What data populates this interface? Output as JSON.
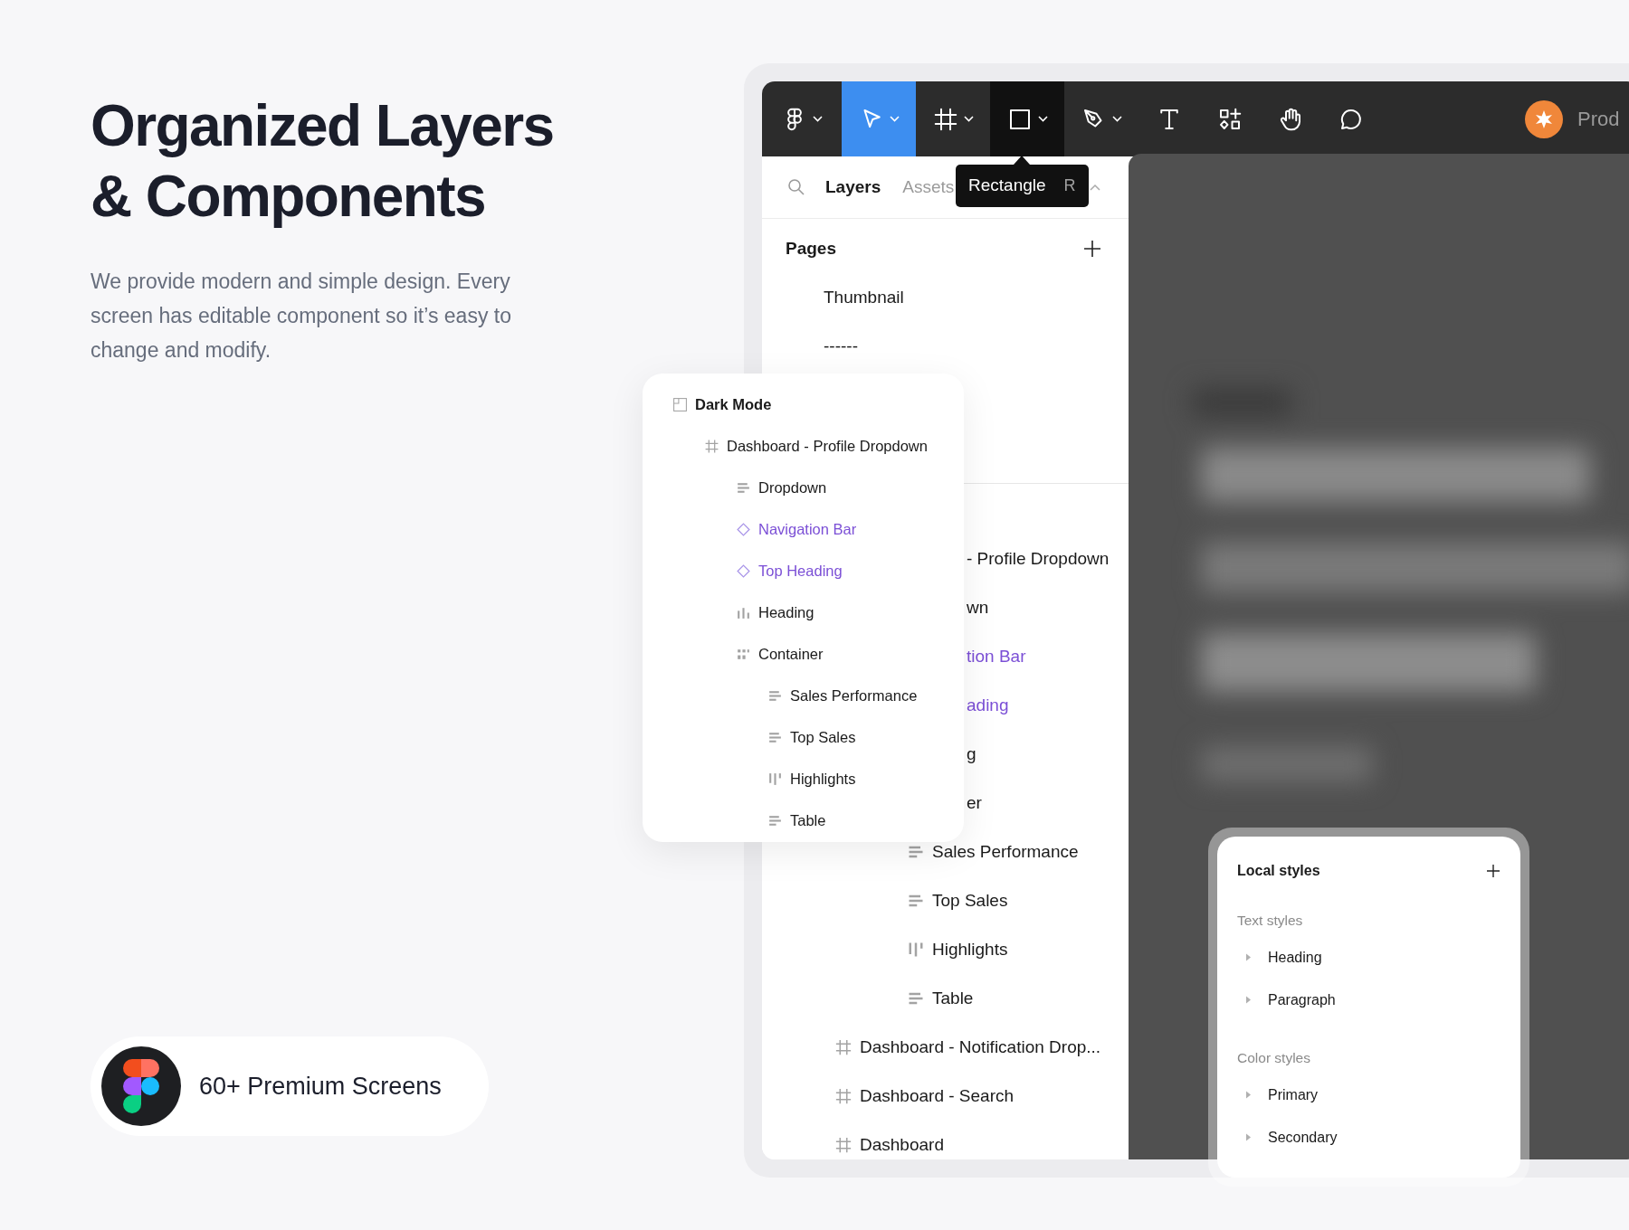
{
  "intro": {
    "title_lines": [
      "Organized Layers",
      "& Components"
    ],
    "description": "We provide modern and simple design. Every screen has editable component so it’s easy to change and modify."
  },
  "badge": {
    "label": "60+ Premium Screens"
  },
  "toolbar": {
    "tools": [
      {
        "kind": "main-menu",
        "selected": false,
        "hovered": false,
        "dropdown": true
      },
      {
        "kind": "move",
        "selected": true,
        "hovered": false,
        "dropdown": true
      },
      {
        "kind": "frame",
        "selected": false,
        "hovered": false,
        "dropdown": true
      },
      {
        "kind": "rectangle",
        "selected": false,
        "hovered": true,
        "dropdown": true
      },
      {
        "kind": "pen",
        "selected": false,
        "hovered": false,
        "dropdown": true
      },
      {
        "kind": "text",
        "selected": false,
        "hovered": false,
        "dropdown": false
      },
      {
        "kind": "resources",
        "selected": false,
        "hovered": false,
        "dropdown": false
      },
      {
        "kind": "hand",
        "selected": false,
        "hovered": false,
        "dropdown": false
      },
      {
        "kind": "comment",
        "selected": false,
        "hovered": false,
        "dropdown": false
      }
    ],
    "file_name": "Prod"
  },
  "tooltip": {
    "label": "Rectangle",
    "shortcut": "R"
  },
  "panel_tabs": [
    {
      "label": "Layers",
      "selected": true
    },
    {
      "label": "Assets",
      "selected": false
    }
  ],
  "pages": {
    "title": "Pages",
    "items": [
      {
        "label": "Thumbnail"
      },
      {
        "label": "------"
      }
    ]
  },
  "layers": [
    {
      "label": "- Profile Dropdown",
      "kind": "frame",
      "cut": true,
      "children": [
        {
          "label": "wn",
          "kind": "vstack",
          "cut": true
        },
        {
          "label": "tion Bar",
          "kind": "component",
          "cut": true
        },
        {
          "label": "ading",
          "kind": "component",
          "cut": true
        },
        {
          "label": "g",
          "kind": "hstack-bottom",
          "cut": true
        },
        {
          "label": "er",
          "kind": "grid",
          "cut": true,
          "children": [
            {
              "label": "Sales Performance",
              "kind": "vstack"
            },
            {
              "label": "Top Sales",
              "kind": "vstack"
            },
            {
              "label": "Highlights",
              "kind": "hstack-top"
            },
            {
              "label": "Table",
              "kind": "vstack"
            }
          ]
        }
      ]
    },
    {
      "label": "Dashboard - Notification Drop...",
      "kind": "frame"
    },
    {
      "label": "Dashboard - Search",
      "kind": "frame"
    },
    {
      "label": "Dashboard",
      "kind": "frame"
    }
  ],
  "floating_layers": [
    {
      "label": "Dark Mode",
      "kind": "page",
      "children": [
        {
          "label": "Dashboard - Profile Dropdown",
          "kind": "frame",
          "children": [
            {
              "label": "Dropdown",
              "kind": "vstack"
            },
            {
              "label": "Navigation Bar",
              "kind": "component"
            },
            {
              "label": "Top Heading",
              "kind": "component"
            },
            {
              "label": "Heading",
              "kind": "hstack-bottom"
            },
            {
              "label": "Container",
              "kind": "grid",
              "children": [
                {
                  "label": "Sales Performance",
                  "kind": "vstack"
                },
                {
                  "label": "Top Sales",
                  "kind": "vstack"
                },
                {
                  "label": "Highlights",
                  "kind": "hstack-top"
                },
                {
                  "label": "Table",
                  "kind": "vstack"
                }
              ]
            }
          ]
        }
      ]
    }
  ],
  "local_styles": {
    "title": "Local styles",
    "groups": [
      {
        "title": "Text styles",
        "items": [
          {
            "label": "Heading",
            "expanded": false
          },
          {
            "label": "Paragraph",
            "expanded": false
          }
        ]
      },
      {
        "title": "Color styles",
        "items": [
          {
            "label": "Primary",
            "expanded": false
          },
          {
            "label": "Secondary",
            "expanded": false
          }
        ]
      }
    ]
  }
}
